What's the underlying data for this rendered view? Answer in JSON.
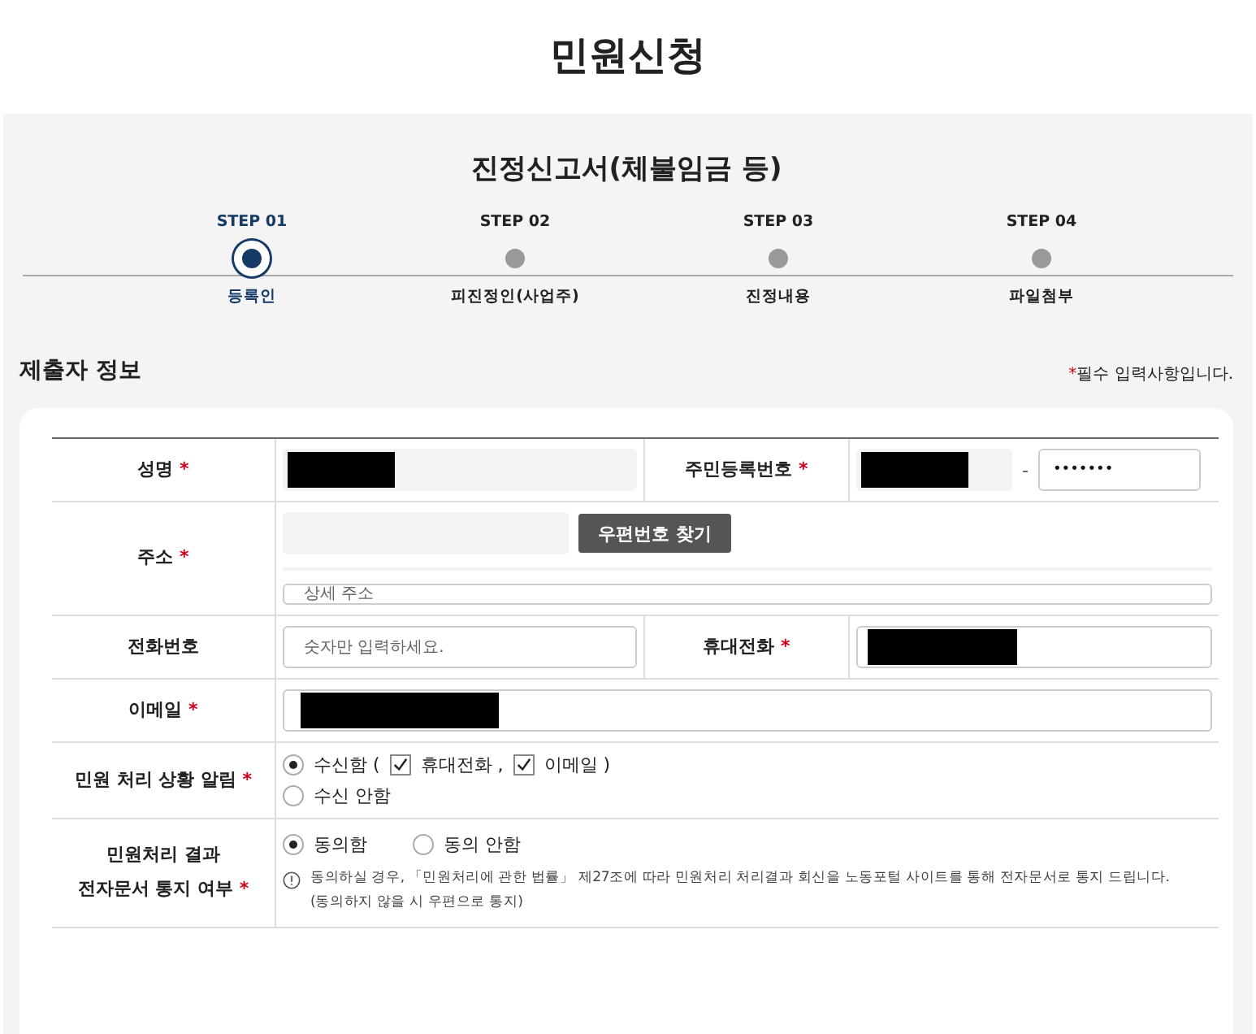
{
  "page_title": "민원신청",
  "form_title": "진정신고서(체불임금 등)",
  "steps": [
    {
      "number": "STEP 01",
      "label": "등록인",
      "selected": true
    },
    {
      "number": "STEP 02",
      "label": "피진정인(사업주)",
      "selected": false
    },
    {
      "number": "STEP 03",
      "label": "진정내용",
      "selected": false
    },
    {
      "number": "STEP 04",
      "label": "파일첨부",
      "selected": false
    }
  ],
  "section": {
    "title": "제출자 정보",
    "required_mark": "*",
    "required_note": "필수 입력사항입니다."
  },
  "name": {
    "label": "성명",
    "required": true
  },
  "rrn": {
    "label": "주민등록번호",
    "required": true,
    "separator": "-",
    "back_value": "•••••••"
  },
  "address": {
    "label": "주소",
    "required": true,
    "button": "우편번호 찾기",
    "detail_placeholder": "상세 주소"
  },
  "phone": {
    "label": "전화번호",
    "required": false,
    "placeholder": "숫자만 입력하세요."
  },
  "mobile": {
    "label": "휴대전화",
    "required": true
  },
  "email": {
    "label": "이메일",
    "required": true
  },
  "notify": {
    "label": "민원 처리 상황 알림",
    "required": true,
    "options": [
      {
        "label": "수신함 (",
        "selected": true,
        "channels": [
          {
            "label": "휴대전화 ,",
            "checked": true
          },
          {
            "label": "이메일 )",
            "checked": true
          }
        ]
      },
      {
        "label": "수신 안함",
        "selected": false
      }
    ]
  },
  "consent": {
    "label_lines": [
      "민원처리 결과",
      "전자문서 통지 여부"
    ],
    "required": true,
    "options": [
      {
        "label": "동의함",
        "selected": true
      },
      {
        "label": "동의 안함",
        "selected": false
      }
    ],
    "notes": [
      "동의하실 경우, 「민원처리에 관한 법률」 제27조에 따라 민원처리 처리결과 회신을 노동포털 사이트를 통해 전자문서로 통지 드립니다.",
      "(동의하지 않을 시 우편으로 통지)"
    ]
  }
}
